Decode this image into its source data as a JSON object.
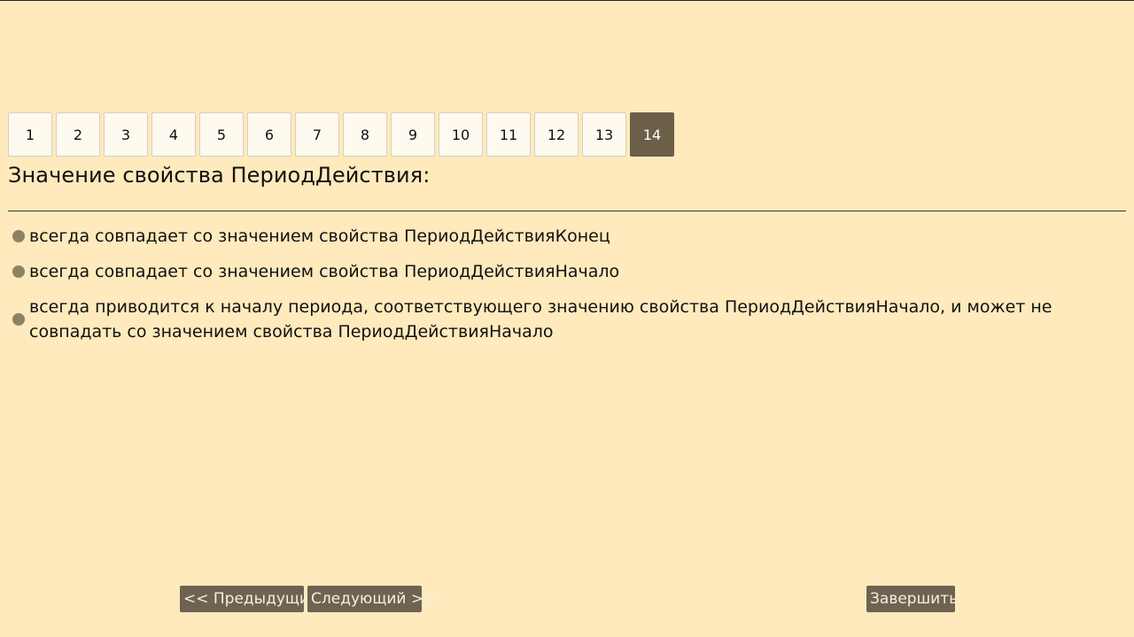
{
  "pagination": {
    "pages": [
      "1",
      "2",
      "3",
      "4",
      "5",
      "6",
      "7",
      "8",
      "9",
      "10",
      "11",
      "12",
      "13",
      "14"
    ],
    "current": "14"
  },
  "question": {
    "title": "Значение свойства ПериодДействия:"
  },
  "options": [
    "всегда совпадает со значением свойства ПериодДействияКонец",
    "всегда совпадает со значением свойства ПериодДействияНачало",
    "всегда приводится к началу периода, соответствующего значению свойства ПериодДействияНачало, и может не совпадать со значением свойства ПериодДействияНачало"
  ],
  "nav": {
    "prev_label": "<< Предыдущий",
    "next_label": "Следующий >>",
    "finish_label": "Завершить"
  },
  "colors": {
    "background": "#ffeabd",
    "page_button": "#fffaf0",
    "page_button_active": "#6b5f48",
    "radio": "#8c8267",
    "nav_button": "#6e6351"
  }
}
